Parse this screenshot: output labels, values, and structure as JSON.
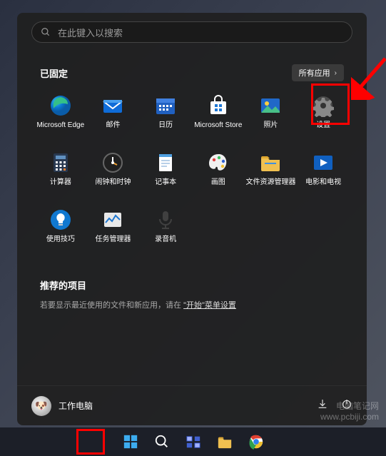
{
  "search": {
    "placeholder": "在此键入以搜索"
  },
  "pinned": {
    "title": "已固定",
    "all_apps": "所有应用",
    "apps": [
      {
        "label": "Microsoft Edge",
        "icon": "edge"
      },
      {
        "label": "邮件",
        "icon": "mail"
      },
      {
        "label": "日历",
        "icon": "calendar"
      },
      {
        "label": "Microsoft Store",
        "icon": "store"
      },
      {
        "label": "照片",
        "icon": "photos"
      },
      {
        "label": "设置",
        "icon": "settings"
      },
      {
        "label": "计算器",
        "icon": "calculator"
      },
      {
        "label": "闹钟和时钟",
        "icon": "clock"
      },
      {
        "label": "记事本",
        "icon": "notepad"
      },
      {
        "label": "画图",
        "icon": "paint"
      },
      {
        "label": "文件资源管理器",
        "icon": "explorer"
      },
      {
        "label": "电影和电视",
        "icon": "movies"
      },
      {
        "label": "使用技巧",
        "icon": "tips"
      },
      {
        "label": "任务管理器",
        "icon": "taskmgr"
      },
      {
        "label": "录音机",
        "icon": "recorder"
      }
    ]
  },
  "recommended": {
    "title": "推荐的项目",
    "hint_prefix": "若要显示最近使用的文件和新应用，请在",
    "hint_link": "\"开始\"菜单设置",
    "hint_suffix": ""
  },
  "user": {
    "name": "工作电脑"
  },
  "watermark": {
    "line1": "电脑笔记网",
    "line2": "www.pcbiji.com"
  }
}
